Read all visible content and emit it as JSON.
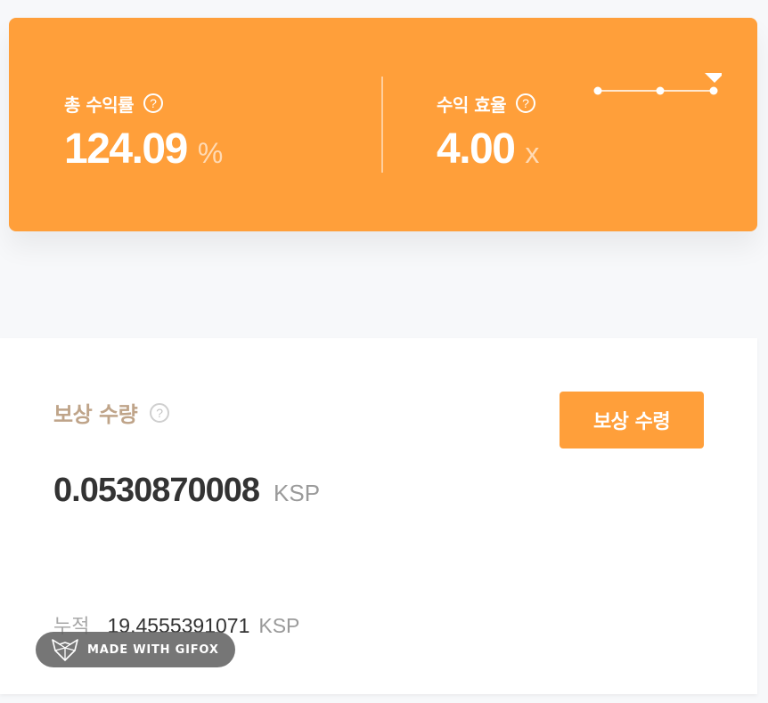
{
  "stats": {
    "total_return": {
      "label": "총 수익률",
      "help": "?",
      "value": "124.09",
      "unit": "%"
    },
    "return_efficiency": {
      "label": "수익 효율",
      "help": "?",
      "value": "4.00",
      "unit": "x"
    },
    "slider": {
      "steps": 3,
      "selected_step": 3
    },
    "colors": {
      "accent": "#ff9f3a"
    }
  },
  "reward": {
    "title": "보상 수량",
    "help": "?",
    "claim_button": "보상 수령",
    "amount": "0.0530870008",
    "amount_unit": "KSP",
    "cumulative_label": "누적",
    "cumulative_value": "19.4555391071",
    "cumulative_unit": "KSP"
  },
  "watermark": {
    "text": "MADE WITH GIFOX",
    "icon": "fox-logo-icon"
  }
}
